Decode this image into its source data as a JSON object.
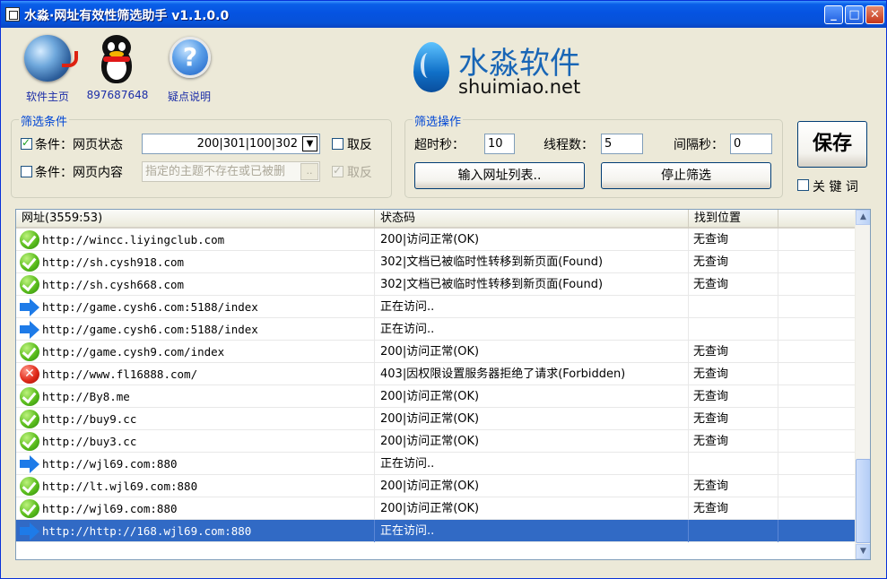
{
  "window": {
    "title": "水淼·网址有效性筛选助手 v1.1.0.0",
    "controls": {
      "minimize": "_",
      "maximize": "□",
      "close": "✕"
    }
  },
  "toolbar": {
    "home_label": "软件主页",
    "qq_label": "897687648",
    "help_label": "疑点说明",
    "help_glyph": "?"
  },
  "logo": {
    "cn": "水淼软件",
    "en": "shuimiao.net"
  },
  "filter": {
    "legend": "筛选条件",
    "cond1_label": "条件：网页状态",
    "cond1_checked": true,
    "cond1_value": "200|301|100|302",
    "cond1_invert_label": "取反",
    "cond1_invert_checked": false,
    "cond2_label": "条件：网页内容",
    "cond2_checked": false,
    "cond2_placeholder": "指定的主题不存在或已被删",
    "cond2_btn": "..",
    "cond2_invert_label": "取反",
    "cond2_invert_checked": true
  },
  "ops": {
    "legend": "筛选操作",
    "timeout_label": "超时秒：",
    "timeout_value": "10",
    "threads_label": "线程数：",
    "threads_value": "5",
    "interval_label": "间隔秒：",
    "interval_value": "0",
    "import_btn": "输入网址列表..",
    "stop_btn": "停止筛选"
  },
  "save": {
    "label": "保存",
    "keyword_label": "关 键 词",
    "keyword_checked": false
  },
  "list": {
    "headers": {
      "url": "网址(3559:53)",
      "status": "状态码",
      "location": "找到位置"
    },
    "rows": [
      {
        "icon": "ok",
        "url": "http://wincc.liyingclub.com",
        "status": "200|访问正常(OK)",
        "location": "无查询"
      },
      {
        "icon": "ok",
        "url": "http://sh.cysh918.com",
        "status": "302|文档已被临时性转移到新页面(Found)",
        "location": "无查询"
      },
      {
        "icon": "ok",
        "url": "http://sh.cysh668.com",
        "status": "302|文档已被临时性转移到新页面(Found)",
        "location": "无查询"
      },
      {
        "icon": "arrow",
        "url": "http://game.cysh6.com:5188/index",
        "status": "正在访问..",
        "location": ""
      },
      {
        "icon": "arrow",
        "url": "http://game.cysh6.com:5188/index",
        "status": "正在访问..",
        "location": ""
      },
      {
        "icon": "ok",
        "url": "http://game.cysh9.com/index",
        "status": "200|访问正常(OK)",
        "location": "无查询"
      },
      {
        "icon": "error",
        "url": "http://www.fl16888.com/",
        "status": "403|因权限设置服务器拒绝了请求(Forbidden)",
        "location": "无查询"
      },
      {
        "icon": "ok",
        "url": "http://By8.me",
        "status": "200|访问正常(OK)",
        "location": "无查询"
      },
      {
        "icon": "ok",
        "url": "http://buy9.cc",
        "status": "200|访问正常(OK)",
        "location": "无查询"
      },
      {
        "icon": "ok",
        "url": "http://buy3.cc",
        "status": "200|访问正常(OK)",
        "location": "无查询"
      },
      {
        "icon": "arrow",
        "url": "http://wjl69.com:880",
        "status": "正在访问..",
        "location": ""
      },
      {
        "icon": "ok",
        "url": "http://lt.wjl69.com:880",
        "status": "200|访问正常(OK)",
        "location": "无查询"
      },
      {
        "icon": "ok",
        "url": "http://wjl69.com:880",
        "status": "200|访问正常(OK)",
        "location": "无查询"
      },
      {
        "icon": "arrow",
        "url": "http://http://168.wjl69.com:880",
        "status": "正在访问..",
        "location": "",
        "selected": true
      }
    ]
  },
  "colors": {
    "title_bar": "#0553e1",
    "selection": "#316ac5",
    "legend_text": "#0046d5",
    "logo_blue": "#1966b6"
  }
}
